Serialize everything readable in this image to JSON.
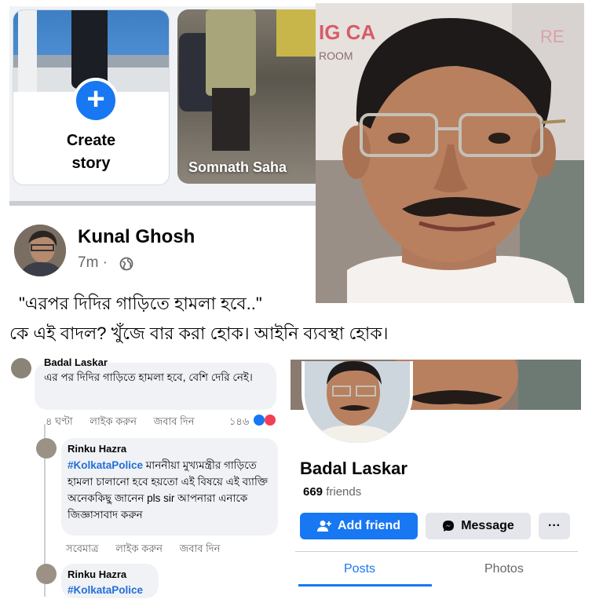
{
  "stories": {
    "create_label_line1": "Create",
    "create_label_line2": "story",
    "plus_icon": "plus",
    "second_story_name": "Somnath Saha"
  },
  "portrait": {
    "sign_text_1": "IG CA",
    "sign_text_2": "ROOM",
    "sign_text_3": "RE"
  },
  "post": {
    "author": "Kunal Ghosh",
    "time": "7m ·",
    "privacy_icon": "globe",
    "headline_line1": "\"এরপর দিদির গাড়িতে হামলা হবে..\"",
    "headline_line2": "কে এই বাদল? খুঁজে বার করা হোক। আইনি ব্যবস্থা হোক।"
  },
  "comments": {
    "first": {
      "name": "Badal Laskar",
      "text": "এর পর দিদির গাড়িতে হামলা হবে, বেশি দেরি নেই।",
      "time": "৪ ঘণ্টা",
      "like": "লাইক করুন",
      "reply": "জবাব দিন",
      "reaction_count": "১৪৬"
    },
    "second": {
      "name": "Rinku Hazra",
      "tag": "#KolkataPolice",
      "text": " মাননীয়া মুখ্যমন্ত্রীর গাড়িতে হামলা চালানো হবে হয়তো এই বিষয়ে এই ব্যাক্তি অনেককিছু জানেন pls sir আপনারা এনাকে জিজ্ঞাসাবাদ করুন",
      "time": "সবেমাত্র",
      "like": "লাইক করুন",
      "reply": "জবাব দিন"
    },
    "third": {
      "name": "Rinku Hazra",
      "tag": "#KolkataPolice"
    }
  },
  "profile": {
    "name": "Badal Laskar",
    "friends_count": "669",
    "friends_label": " friends",
    "add_friend_label": "Add friend",
    "message_label": "Message",
    "more_label": "···",
    "tab_posts": "Posts",
    "tab_photos": "Photos"
  },
  "colors": {
    "accent": "#1877f2",
    "secondary_text": "#65676b",
    "bubble": "#f0f2f5"
  }
}
